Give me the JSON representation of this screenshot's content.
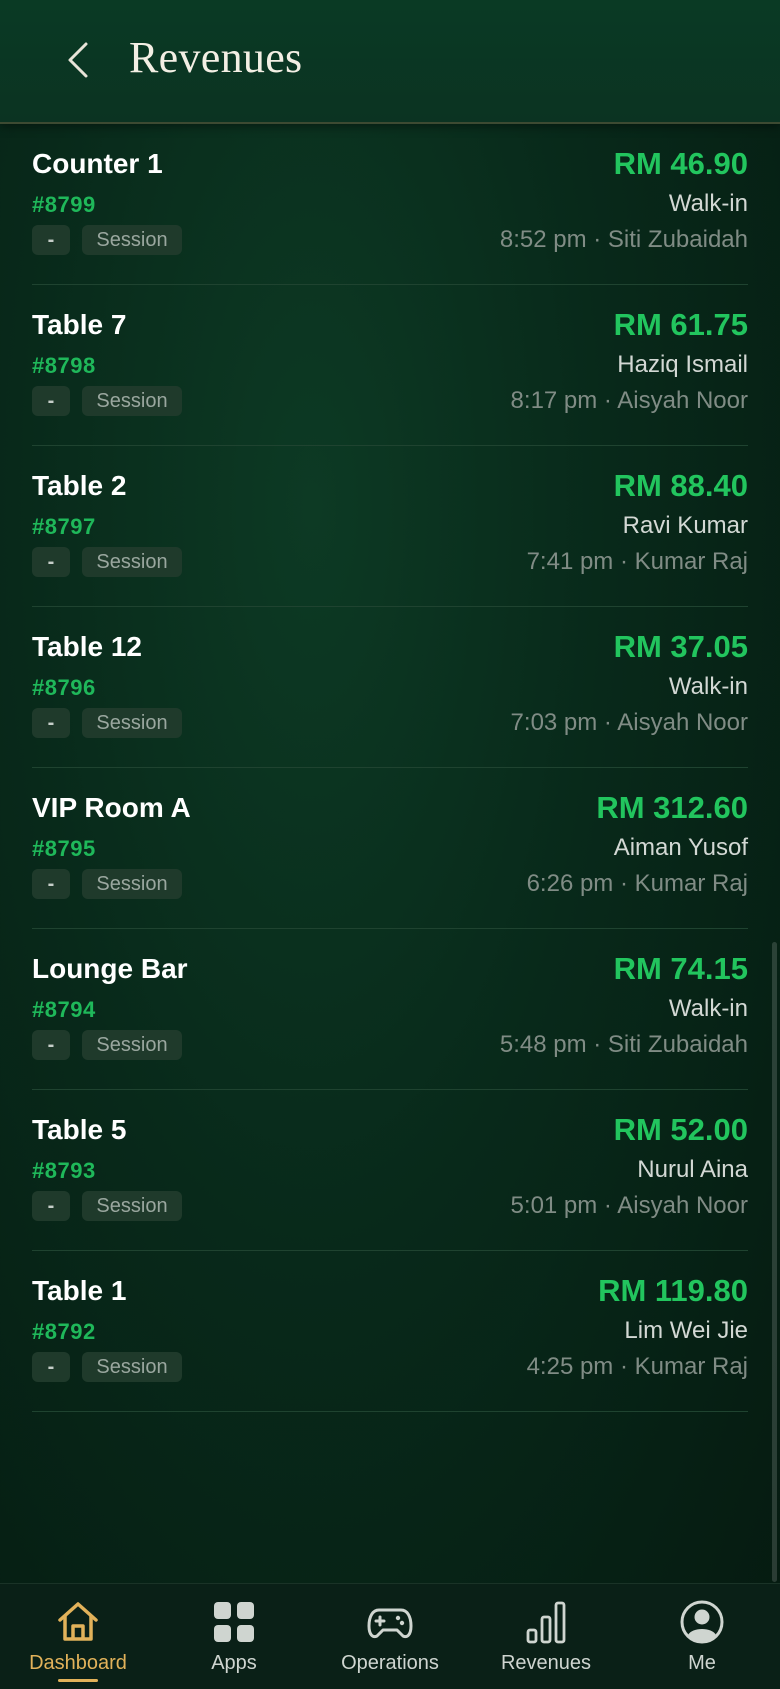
{
  "header": {
    "title": "Revenues"
  },
  "chip": {
    "dash": "-",
    "session": "Session"
  },
  "rows": [
    {
      "name": "Counter 1",
      "id": "#8799",
      "amount": "RM 46.90",
      "customer": "Walk-in",
      "meta": "8:52 pm · Siti Zubaidah"
    },
    {
      "name": "Table 7",
      "id": "#8798",
      "amount": "RM 61.75",
      "customer": "Haziq Ismail",
      "meta": "8:17 pm · Aisyah Noor"
    },
    {
      "name": "Table 2",
      "id": "#8797",
      "amount": "RM 88.40",
      "customer": "Ravi Kumar",
      "meta": "7:41 pm · Kumar Raj"
    },
    {
      "name": "Table 12",
      "id": "#8796",
      "amount": "RM 37.05",
      "customer": "Walk-in",
      "meta": "7:03 pm · Aisyah Noor"
    },
    {
      "name": "VIP Room A",
      "id": "#8795",
      "amount": "RM 312.60",
      "customer": "Aiman Yusof",
      "meta": "6:26 pm · Kumar Raj"
    },
    {
      "name": "Lounge Bar",
      "id": "#8794",
      "amount": "RM 74.15",
      "customer": "Walk-in",
      "meta": "5:48 pm · Siti Zubaidah"
    },
    {
      "name": "Table 5",
      "id": "#8793",
      "amount": "RM 52.00",
      "customer": "Nurul Aina",
      "meta": "5:01 pm · Aisyah Noor"
    },
    {
      "name": "Table 1",
      "id": "#8792",
      "amount": "RM 119.80",
      "customer": "Lim Wei Jie",
      "meta": "4:25 pm · Kumar Raj"
    }
  ],
  "tabs": [
    {
      "label": "Dashboard",
      "icon": "home-icon",
      "active": true
    },
    {
      "label": "Apps",
      "icon": "apps-grid-icon",
      "active": false
    },
    {
      "label": "Operations",
      "icon": "gamepad-icon",
      "active": false
    },
    {
      "label": "Revenues",
      "icon": "bar-chart-icon",
      "active": false
    },
    {
      "label": "Me",
      "icon": "user-avatar-icon",
      "active": false
    }
  ],
  "colors": {
    "accent_green": "#22c55e",
    "accent_gold": "#e2b25a",
    "background": "#08291a"
  }
}
